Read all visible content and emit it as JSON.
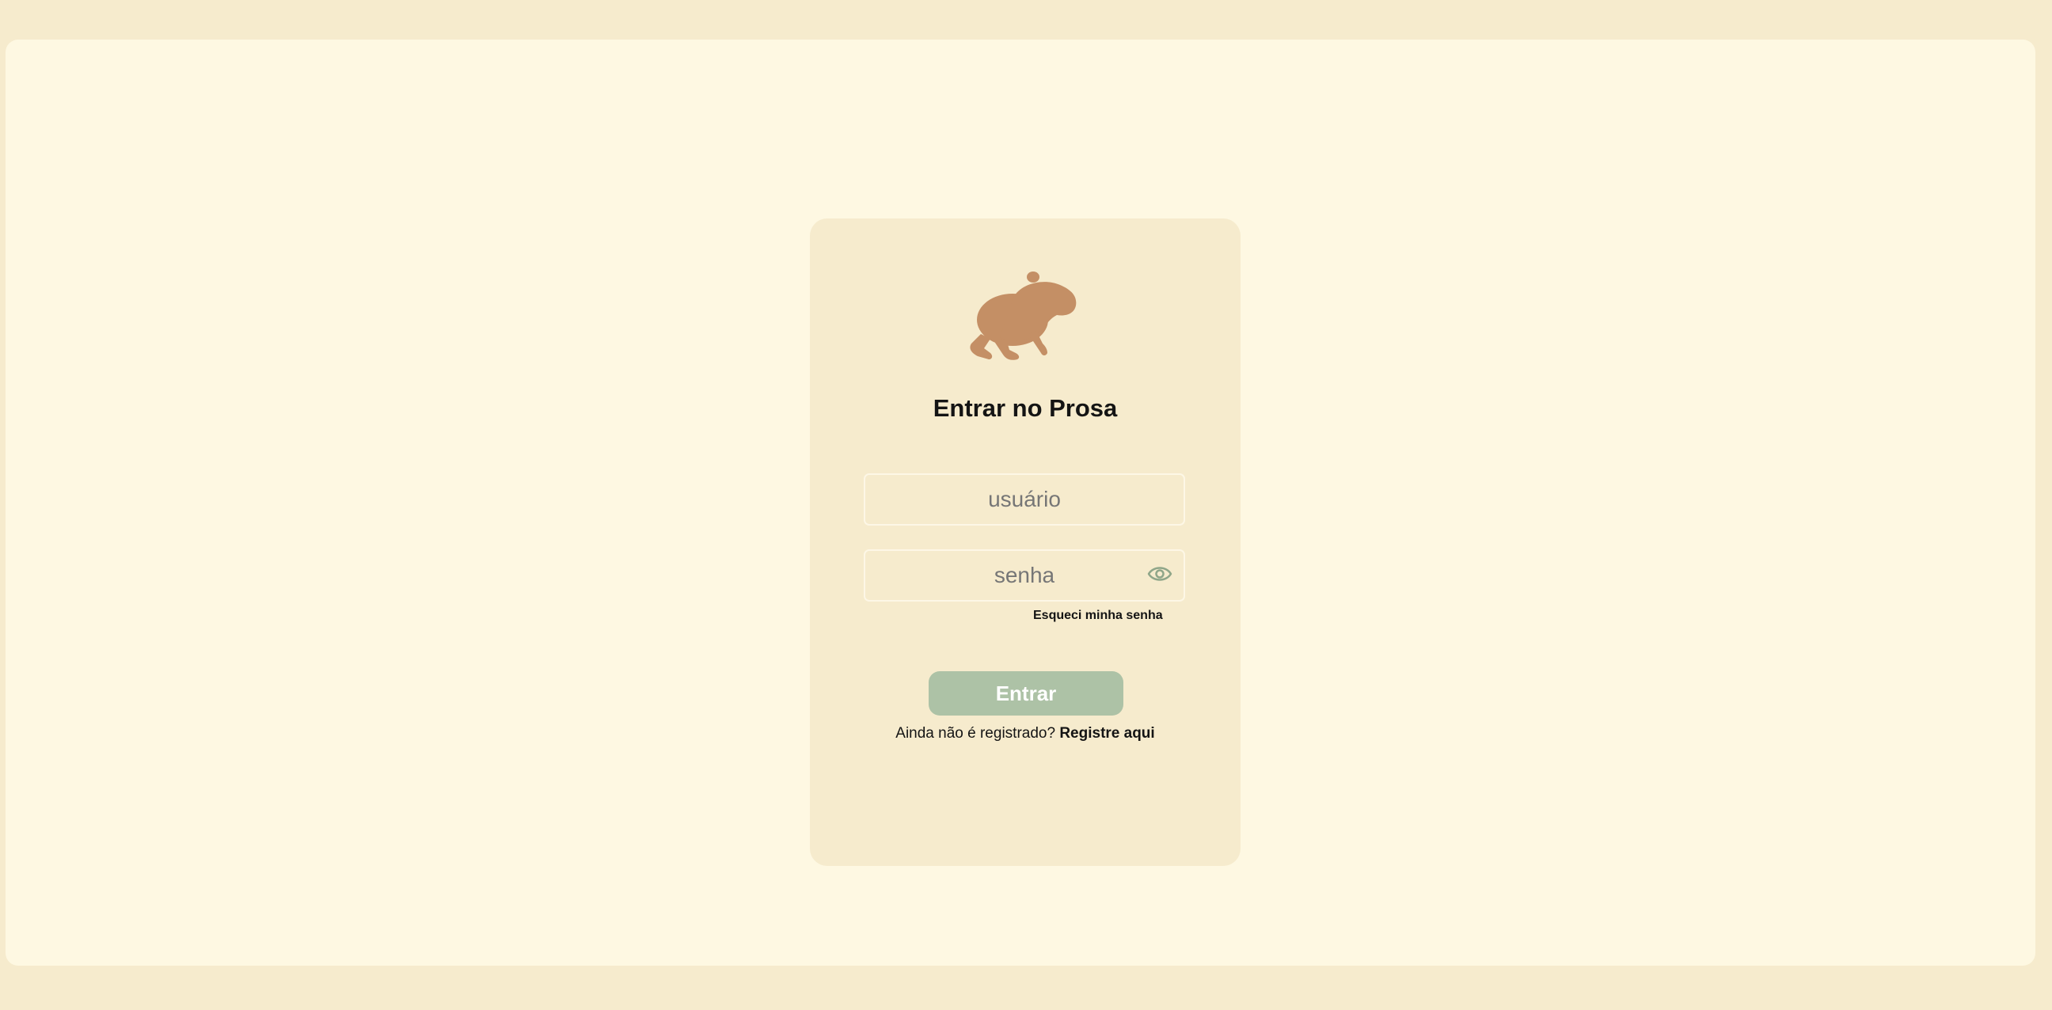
{
  "login": {
    "logo_icon": "capybara-icon",
    "title": "Entrar no Prosa",
    "username_placeholder": "usuário",
    "password_placeholder": "senha",
    "toggle_visibility_icon": "eye-icon",
    "forgot_password": "Esqueci minha senha",
    "submit": "Entrar",
    "register_prompt": "Ainda não é registrado?",
    "register_link": "Registre aqui"
  },
  "colors": {
    "page_background": "#f6ebcd",
    "panel_background": "#fef8e2",
    "card_background": "#f6ebcd",
    "logo": "#c48f65",
    "button": "#adc2a6",
    "button_text": "#ffffff",
    "text": "#141414",
    "placeholder": "#767676",
    "eye_icon": "#8fa689"
  }
}
